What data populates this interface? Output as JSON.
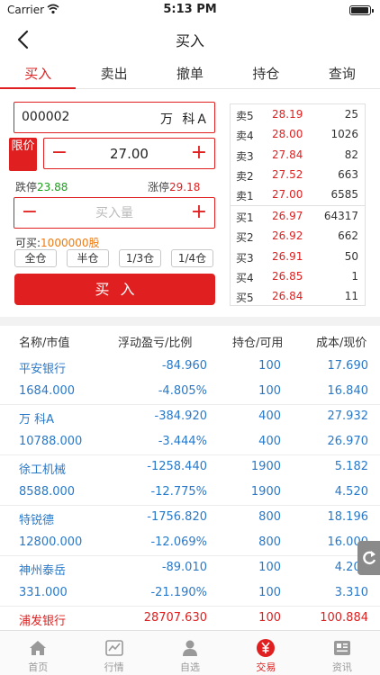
{
  "status": {
    "carrier": "Carrier",
    "time": "5:13 PM"
  },
  "nav": {
    "title": "买入"
  },
  "tabs": [
    "买入",
    "卖出",
    "撤单",
    "持仓",
    "查询"
  ],
  "form": {
    "stock_code": "000002",
    "stock_name": "万 科A",
    "price_type": "限价",
    "price": "27.00",
    "limit_down_label": "跌停",
    "limit_down": "23.88",
    "limit_up_label": "涨停",
    "limit_up": "29.18",
    "qty_placeholder": "买入量",
    "can_buy_label": "可买:",
    "can_buy_amount": "1000000股",
    "positions": [
      "全仓",
      "半仓",
      "1/3仓",
      "1/4仓"
    ],
    "buy_button": "买入",
    "minus_symbol": "−",
    "plus_symbol": "+"
  },
  "order_book": {
    "asks": [
      {
        "label": "卖5",
        "price": "28.19",
        "volume": "25"
      },
      {
        "label": "卖4",
        "price": "28.00",
        "volume": "1026"
      },
      {
        "label": "卖3",
        "price": "27.84",
        "volume": "82"
      },
      {
        "label": "卖2",
        "price": "27.52",
        "volume": "663"
      },
      {
        "label": "卖1",
        "price": "27.00",
        "volume": "6585"
      }
    ],
    "bids": [
      {
        "label": "买1",
        "price": "26.97",
        "volume": "64317"
      },
      {
        "label": "买2",
        "price": "26.92",
        "volume": "662"
      },
      {
        "label": "买3",
        "price": "26.91",
        "volume": "50"
      },
      {
        "label": "买4",
        "price": "26.85",
        "volume": "1"
      },
      {
        "label": "买5",
        "price": "26.84",
        "volume": "11"
      }
    ]
  },
  "holdings": {
    "headers": [
      "名称/市值",
      "浮动盈亏/比例",
      "持仓/可用",
      "成本/现价"
    ],
    "rows": [
      {
        "name": "平安银行",
        "pnl": "-84.960",
        "position": "100",
        "cost": "17.690",
        "market_value": "1684.000",
        "ratio": "-4.805%",
        "available": "100",
        "current": "16.840"
      },
      {
        "name": "万 科A",
        "pnl": "-384.920",
        "position": "400",
        "cost": "27.932",
        "market_value": "10788.000",
        "ratio": "-3.444%",
        "available": "400",
        "current": "26.970"
      },
      {
        "name": "徐工机械",
        "pnl": "-1258.440",
        "position": "1900",
        "cost": "5.182",
        "market_value": "8588.000",
        "ratio": "-12.775%",
        "available": "1900",
        "current": "4.520"
      },
      {
        "name": "特锐德",
        "pnl": "-1756.820",
        "position": "800",
        "cost": "18.196",
        "market_value": "12800.000",
        "ratio": "-12.069%",
        "available": "800",
        "current": "16.000"
      },
      {
        "name": "神州泰岳",
        "pnl": "-89.010",
        "position": "100",
        "cost": "4.200",
        "market_value": "331.000",
        "ratio": "-21.190%",
        "available": "100",
        "current": "3.310"
      },
      {
        "name": "浦发银行",
        "pnl": "28707.630",
        "position": "100",
        "cost": "100.884"
      }
    ]
  },
  "tabbar": [
    {
      "label": "首页",
      "icon": "home-icon"
    },
    {
      "label": "行情",
      "icon": "chart-icon"
    },
    {
      "label": "自选",
      "icon": "user-icon"
    },
    {
      "label": "交易",
      "icon": "trade-icon",
      "active": true
    },
    {
      "label": "资讯",
      "icon": "news-icon"
    }
  ],
  "colors": {
    "accent": "#e02020",
    "link": "#2979c9",
    "up_green": "#1aa01a",
    "amount_orange": "#f07a10"
  }
}
